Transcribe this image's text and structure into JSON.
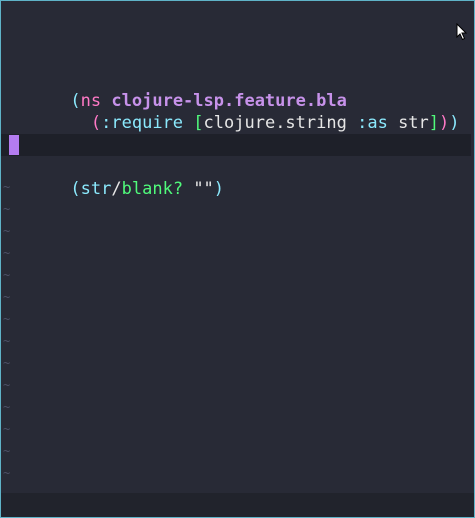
{
  "editor": {
    "lines": {
      "l1": {
        "open": "(",
        "kw": "ns",
        "space": " ",
        "ns_name": "clojure-lsp.feature.bla"
      },
      "l2": {
        "indent": "  ",
        "open": "(",
        "keyword": ":require",
        "space": " ",
        "bopen": "[",
        "lib": "clojure.string",
        "space2": " ",
        "as": ":as",
        "space3": " ",
        "alias": "str",
        "bclose": "]",
        "close_inner": ")",
        "close_outer": ")"
      },
      "l4": {
        "open": "(",
        "alias": "str",
        "slash": "/",
        "fn": "blank?",
        "space": " ",
        "str": "\"\"",
        "close": ")"
      }
    },
    "empty_line_marker": "~"
  },
  "colors": {
    "background": "#282a36",
    "border": "#5fb3c8",
    "cursor": "#b47cf0",
    "current_line": "#1e2029"
  }
}
